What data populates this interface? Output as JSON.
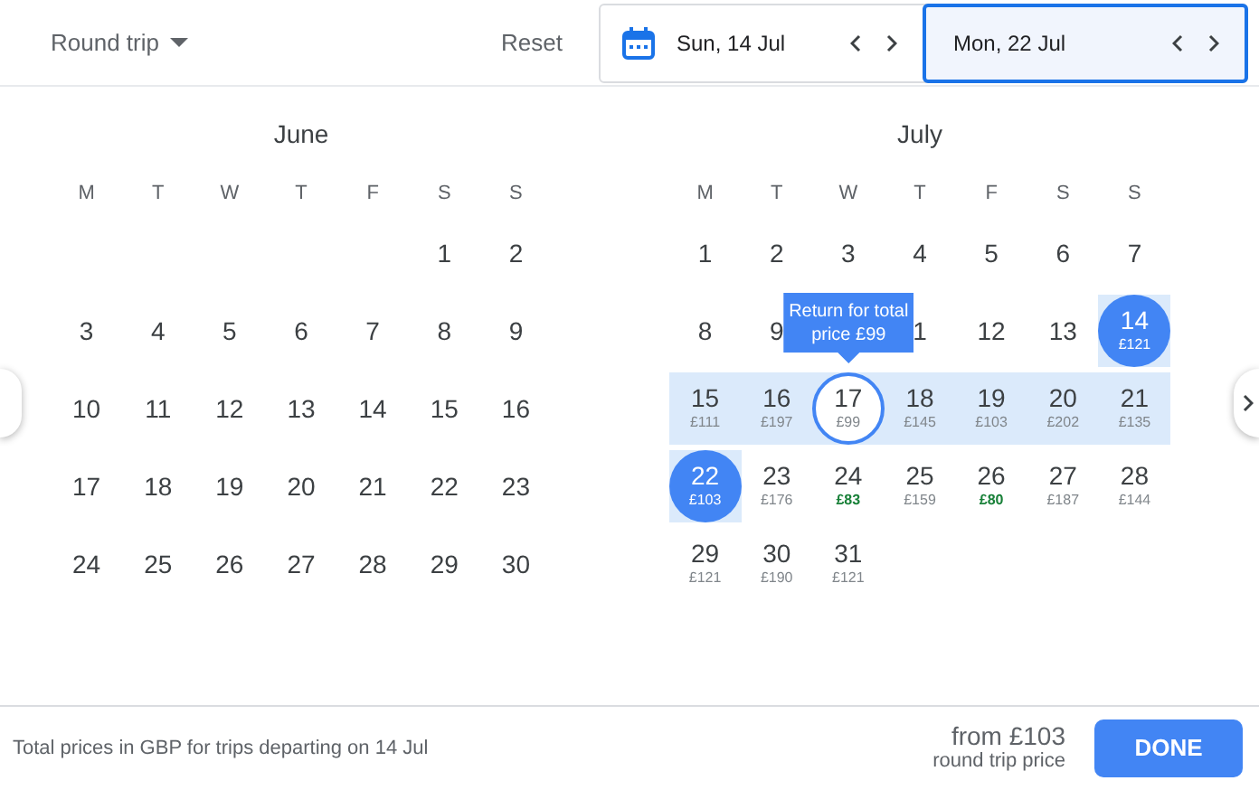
{
  "trip_type": {
    "label": "Round trip"
  },
  "reset": "Reset",
  "date_fields": [
    {
      "value": "Sun, 14 Jul",
      "selected": false,
      "has_icon": true
    },
    {
      "value": "Mon, 22 Jul",
      "selected": true,
      "has_icon": false
    }
  ],
  "months": [
    {
      "title": "June",
      "weekdays": [
        "M",
        "T",
        "W",
        "T",
        "F",
        "S",
        "S"
      ],
      "weeks": [
        [
          {
            "day": "1"
          },
          {
            "day": "2"
          }
        ],
        [
          {
            "day": "3"
          },
          {
            "day": "4"
          },
          {
            "day": "5"
          },
          {
            "day": "6"
          },
          {
            "day": "7"
          },
          {
            "day": "8"
          },
          {
            "day": "9"
          }
        ],
        [
          {
            "day": "10"
          },
          {
            "day": "11"
          },
          {
            "day": "12"
          },
          {
            "day": "13"
          },
          {
            "day": "14"
          },
          {
            "day": "15"
          },
          {
            "day": "16"
          }
        ],
        [
          {
            "day": "17"
          },
          {
            "day": "18"
          },
          {
            "day": "19"
          },
          {
            "day": "20"
          },
          {
            "day": "21"
          },
          {
            "day": "22"
          },
          {
            "day": "23"
          }
        ],
        [
          {
            "day": "24"
          },
          {
            "day": "25"
          },
          {
            "day": "26"
          },
          {
            "day": "27"
          },
          {
            "day": "28"
          },
          {
            "day": "29"
          },
          {
            "day": "30"
          }
        ]
      ]
    },
    {
      "title": "July",
      "weekdays": [
        "M",
        "T",
        "W",
        "T",
        "F",
        "S",
        "S"
      ],
      "weeks": [
        [
          {
            "day": "1"
          },
          {
            "day": "2"
          },
          {
            "day": "3"
          },
          {
            "day": "4"
          },
          {
            "day": "5"
          },
          {
            "day": "6"
          },
          {
            "day": "7"
          }
        ],
        [
          {
            "day": "8"
          },
          {
            "day": "9"
          },
          {
            "tooltip": "Return for total price £99"
          },
          {
            "day": "1"
          },
          {
            "day": "12"
          },
          {
            "day": "13"
          },
          {
            "day": "14",
            "price": "£121",
            "selected": true,
            "in_range": true
          }
        ],
        [
          {
            "day": "15",
            "price": "£111",
            "in_range": true
          },
          {
            "day": "16",
            "price": "£197",
            "in_range": true
          },
          {
            "day": "17",
            "price": "£99",
            "in_range": true,
            "hovered": true
          },
          {
            "day": "18",
            "price": "£145",
            "in_range": true
          },
          {
            "day": "19",
            "price": "£103",
            "in_range": true
          },
          {
            "day": "20",
            "price": "£202",
            "in_range": true
          },
          {
            "day": "21",
            "price": "£135",
            "in_range": true
          }
        ],
        [
          {
            "day": "22",
            "price": "£103",
            "selected": true,
            "in_range": true
          },
          {
            "day": "23",
            "price": "£176"
          },
          {
            "day": "24",
            "price": "£83",
            "cheap": true
          },
          {
            "day": "25",
            "price": "£159"
          },
          {
            "day": "26",
            "price": "£80",
            "cheap": true
          },
          {
            "day": "27",
            "price": "£187"
          },
          {
            "day": "28",
            "price": "£144"
          }
        ],
        [
          {
            "day": "29",
            "price": "£121"
          },
          {
            "day": "30",
            "price": "£190"
          },
          {
            "day": "31",
            "price": "£121"
          }
        ]
      ]
    }
  ],
  "footer": {
    "note": "Total prices in GBP for trips departing on 14 Jul",
    "price": "from £103",
    "price_caption": "round trip price",
    "done": "DONE"
  }
}
